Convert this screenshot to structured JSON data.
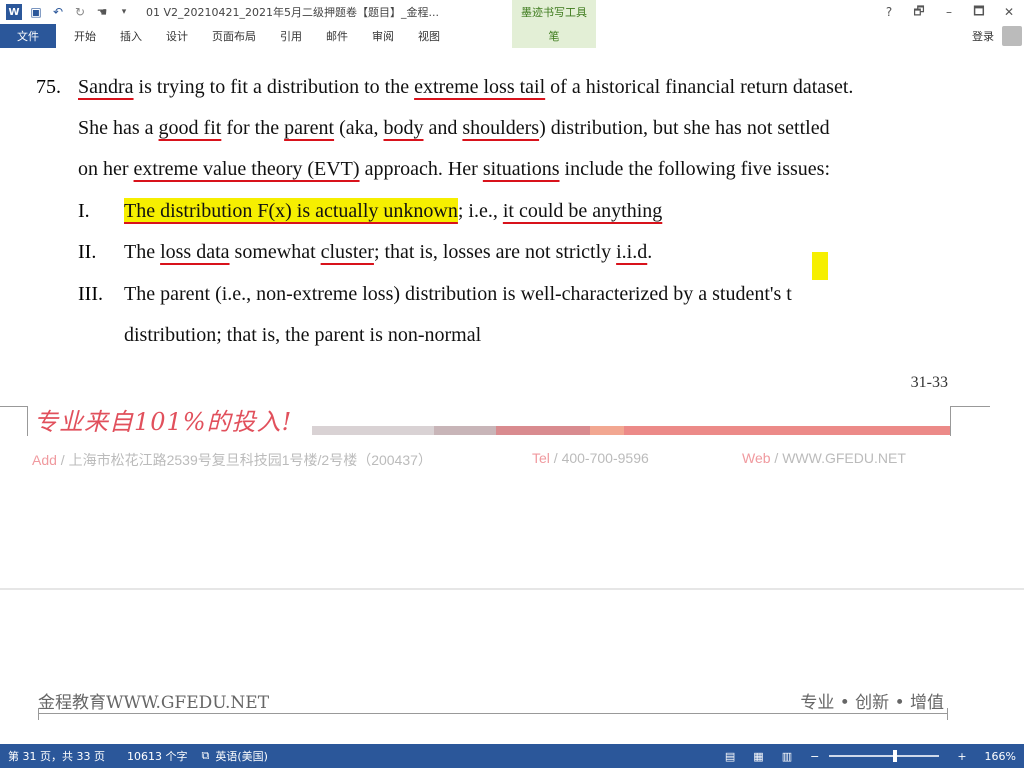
{
  "titlebar": {
    "doc_title": "01 V2_20210421_2021年5月二级押题卷【题目】_金程...",
    "tool_context": "墨迹书写工具",
    "help": "?",
    "restore": "🗗",
    "minimize": "–",
    "maximize": "🗖",
    "close": "✕"
  },
  "ribbon": {
    "file": "文件",
    "tabs": [
      "开始",
      "插入",
      "设计",
      "页面布局",
      "引用",
      "邮件",
      "审阅",
      "视图"
    ],
    "pen": "笔",
    "login": "登录"
  },
  "question": {
    "number": "75.",
    "line1_a": "Sandra",
    "line1_b": " is trying to fit a distribution to the ",
    "line1_c": "extreme loss tail",
    "line1_d": " of a historical financial return dataset.",
    "line2_a": "She has a ",
    "line2_b": "good fit",
    "line2_c": " for the ",
    "line2_d": "parent",
    "line2_e": " (aka, ",
    "line2_f": "body",
    "line2_g": " and ",
    "line2_h": "shoulders",
    "line2_i": ") distribution, but she has not settled",
    "line3_a": "on her ",
    "line3_b": "extreme value theory (EVT)",
    "line3_c": " approach. Her ",
    "line3_d": "situations",
    "line3_e": " include the following five issues:",
    "items": [
      {
        "roman": "I.",
        "a": "The distribution F(x) is actually unknown",
        "b": "; i.e., ",
        "c": "it could be anything"
      },
      {
        "roman": "II.",
        "a": "The ",
        "b": "loss data",
        "c": " somewhat ",
        "d": "cluster",
        "e": "; that is, losses are not strictly ",
        "f": "i.i.d",
        "g": "."
      },
      {
        "roman": "III.",
        "line1": "The  parent  (i.e.,  non-extreme  loss)  distribution  is  well-characterized  by  a  student's  t",
        "line2": "distribution; that is, the parent is non-normal"
      }
    ]
  },
  "page_ref": "31-33",
  "banner": {
    "slogan": "专业来自101%的投入!",
    "add_key": "Add",
    "add_val": " / 上海市松花江路2539号复旦科技园1号楼/2号楼（200437）",
    "tel_key": "Tel",
    "tel_val": " / 400-700-9596",
    "web_key": "Web",
    "web_val": " / WWW.GFEDU.NET"
  },
  "footer": {
    "left": "金程教育WWW.GFEDU.NET",
    "right": "专业 • 创新 • 增值"
  },
  "status": {
    "page": "第 31 页，共 33 页",
    "words": "10613 个字",
    "lang": "英语(美国)",
    "zoom": "166%",
    "zoom_minus": "−",
    "zoom_plus": "+"
  },
  "colors": {
    "ribbon_blue": "#2b579a",
    "highlight": "#f6ef00",
    "annotation_red": "#d8121b",
    "banner_pink": "#e1505c"
  }
}
